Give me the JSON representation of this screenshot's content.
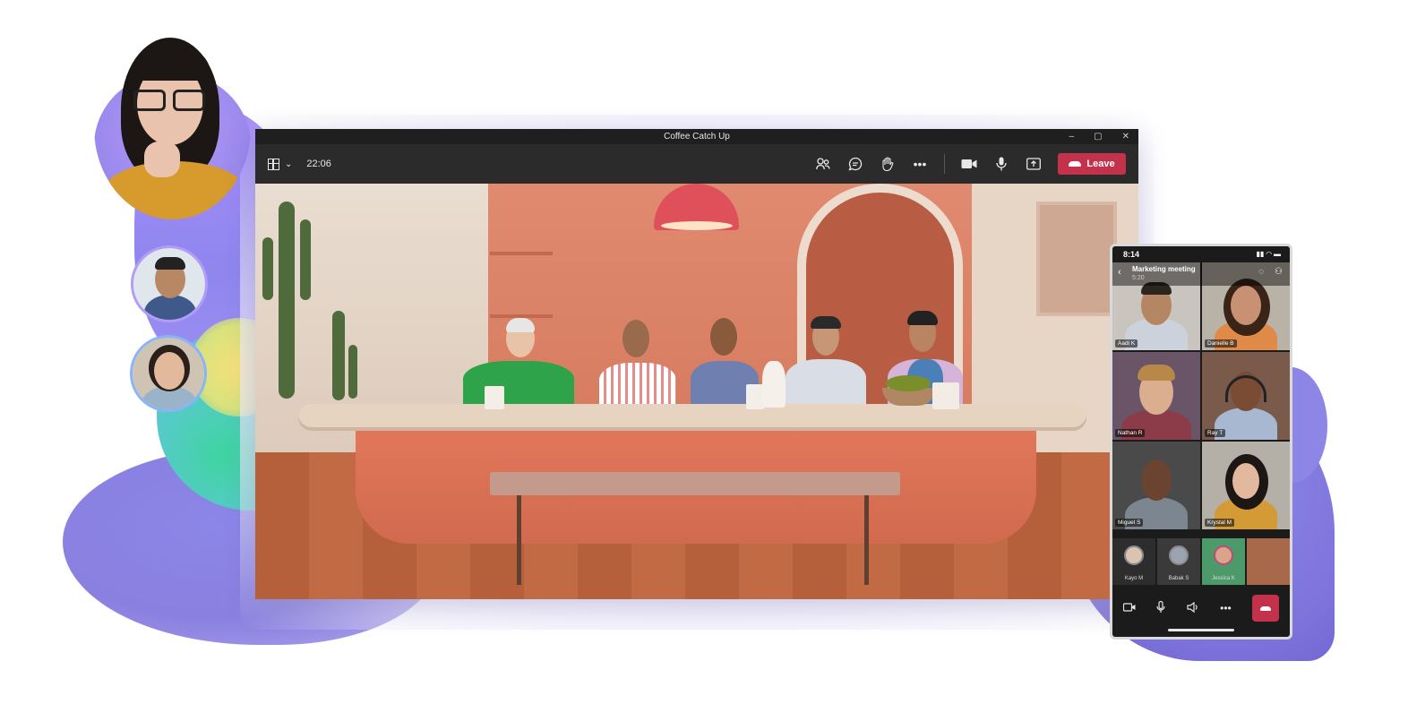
{
  "window": {
    "title": "Coffee Catch Up",
    "timer": "22:06",
    "leave_label": "Leave",
    "controls": {
      "minimize": "–",
      "restore": "▢",
      "close": "✕"
    },
    "toolbar_icons": [
      "people-icon",
      "chat-icon",
      "raise-hand-icon",
      "more-icon",
      "camera-icon",
      "mic-icon",
      "share-icon"
    ],
    "accent_color": "#c4314b"
  },
  "phone": {
    "clock": "8:14",
    "meeting_title": "Marketing meeting",
    "meeting_time": "5:20",
    "tiles": [
      {
        "name": "Aadi K"
      },
      {
        "name": "Danielle B"
      },
      {
        "name": "Nathan R"
      },
      {
        "name": "Ray T"
      },
      {
        "name": "Miguel S"
      },
      {
        "name": "Krystal M"
      }
    ],
    "mini": [
      {
        "name": "Kayo M"
      },
      {
        "name": "Babak S"
      },
      {
        "name": "Jessica K"
      },
      {
        "name": ""
      }
    ]
  }
}
